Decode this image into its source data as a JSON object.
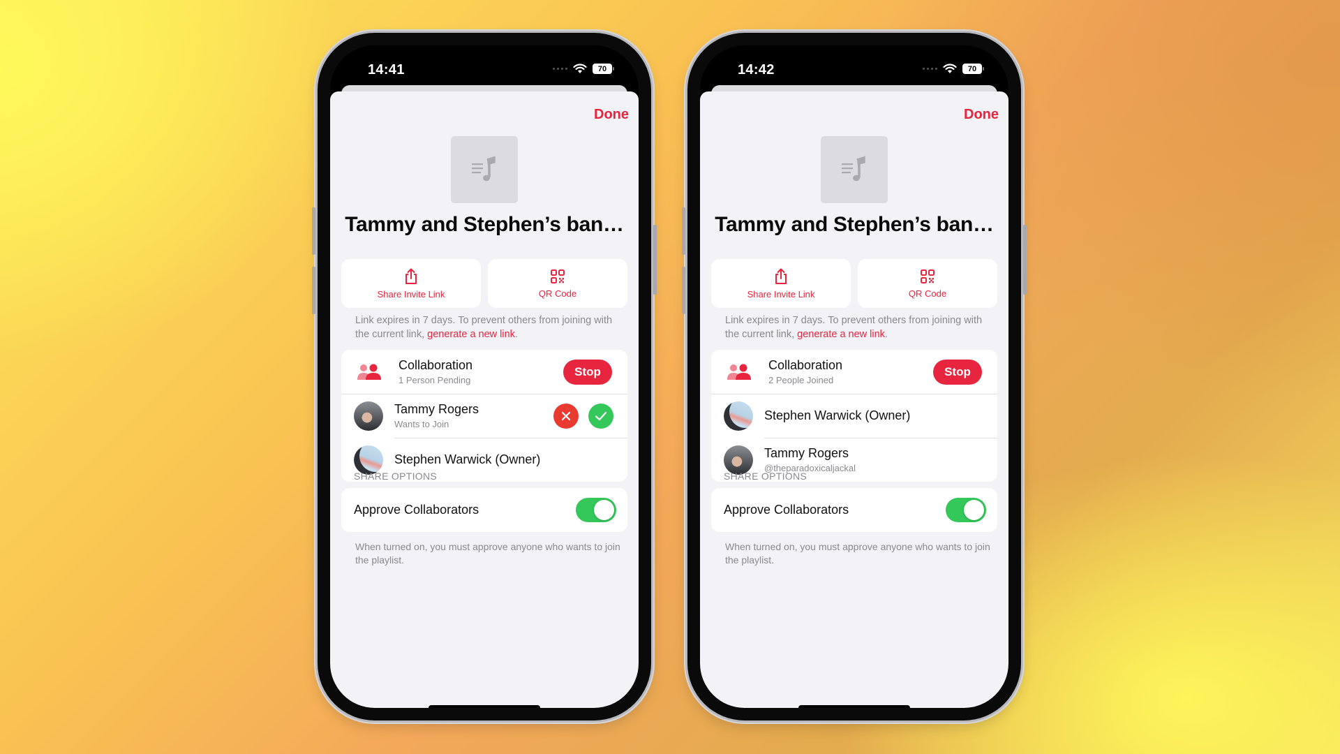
{
  "colors": {
    "accent": "#e8253f",
    "toggle_on": "#34c759",
    "decline": "#e83a31",
    "approve": "#34c759",
    "sheet_bg": "#f2f2f7"
  },
  "phones": [
    {
      "status": {
        "time": "14:41",
        "battery": "70"
      },
      "done_label": "Done",
      "playlist_title": "Tammy and Stephen’s ban…",
      "actions": {
        "share_invite_link": "Share Invite Link",
        "qr_code": "QR Code"
      },
      "link_note": {
        "text": "Link expires in 7 days. To prevent others from joining with the current link, ",
        "link": "generate a new link",
        "end": "."
      },
      "collaboration": {
        "title": "Collaboration",
        "subtitle": "1 Person Pending",
        "stop_label": "Stop"
      },
      "members": [
        {
          "name": "Tammy Rogers",
          "subtitle": "Wants to Join",
          "pending": true,
          "avatar": "tammy"
        },
        {
          "name": "Stephen Warwick (Owner)",
          "subtitle": "",
          "pending": false,
          "avatar": "stephen"
        }
      ],
      "share_options": {
        "header": "SHARE OPTIONS",
        "approve_label": "Approve Collaborators",
        "approve_on": true,
        "note": "When turned on, you must approve anyone who wants to join the playlist."
      }
    },
    {
      "status": {
        "time": "14:42",
        "battery": "70"
      },
      "done_label": "Done",
      "playlist_title": "Tammy and Stephen’s ban…",
      "actions": {
        "share_invite_link": "Share Invite Link",
        "qr_code": "QR Code"
      },
      "link_note": {
        "text": "Link expires in 7 days. To prevent others from joining with the current link, ",
        "link": "generate a new link",
        "end": "."
      },
      "collaboration": {
        "title": "Collaboration",
        "subtitle": "2 People Joined",
        "stop_label": "Stop"
      },
      "members": [
        {
          "name": "Stephen Warwick (Owner)",
          "subtitle": "",
          "pending": false,
          "avatar": "stephen"
        },
        {
          "name": "Tammy Rogers",
          "subtitle": "@theparadoxicaljackal",
          "pending": false,
          "avatar": "tammy"
        }
      ],
      "share_options": {
        "header": "SHARE OPTIONS",
        "approve_label": "Approve Collaborators",
        "approve_on": true,
        "note": "When turned on, you must approve anyone who wants to join the playlist."
      }
    }
  ]
}
